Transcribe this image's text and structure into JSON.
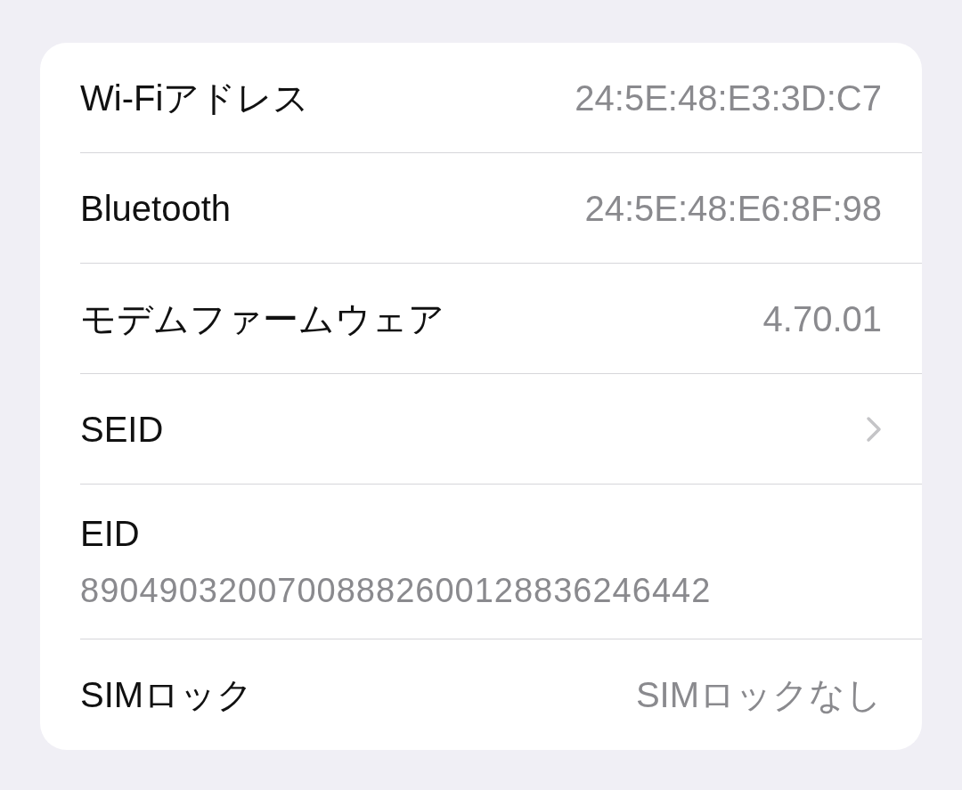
{
  "rows": [
    {
      "kind": "value",
      "label": "Wi-Fiアドレス",
      "value": "24:5E:48:E3:3D:C7"
    },
    {
      "kind": "value",
      "label": "Bluetooth",
      "value": "24:5E:48:E6:8F:98"
    },
    {
      "kind": "value",
      "label": "モデムファームウェア",
      "value": "4.70.01"
    },
    {
      "kind": "link",
      "label": "SEID"
    },
    {
      "kind": "stacked",
      "label": "EID",
      "value": "89049032007008882600128836246442"
    },
    {
      "kind": "value",
      "label": "SIMロック",
      "value": "SIMロックなし"
    }
  ]
}
